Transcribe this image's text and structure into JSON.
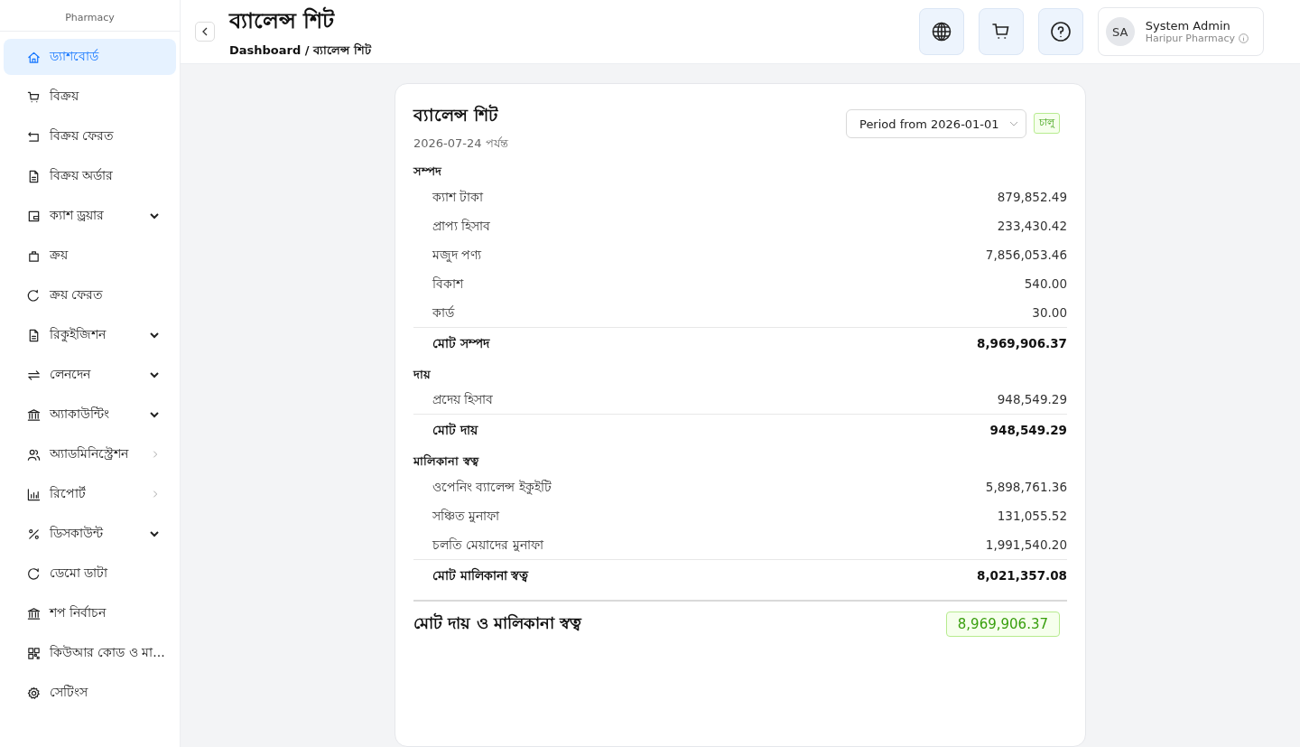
{
  "sidebar": {
    "brand_subtitle": "Pharmacy",
    "items": [
      {
        "label": "ড্যাশবোর্ড",
        "selected": true
      },
      {
        "label": "বিক্রয়",
        "selected": false
      },
      {
        "label": "বিক্রয় ফেরত",
        "selected": false
      },
      {
        "label": "বিক্রয় অর্ডার",
        "selected": false
      },
      {
        "label": "ক্যাশ ড্রয়ার",
        "selected": false,
        "kind": "submenu"
      },
      {
        "label": "ক্রয়",
        "selected": false
      },
      {
        "label": "ক্রয় ফেরত",
        "selected": false
      },
      {
        "label": "রিকুইজিশন",
        "selected": false,
        "kind": "submenu"
      },
      {
        "label": "লেনদেন",
        "selected": false,
        "kind": "submenu"
      },
      {
        "label": "অ্যাকাউন্টিং",
        "selected": false,
        "kind": "submenu"
      },
      {
        "label": "অ্যাডমিনিস্ট্রেশন",
        "selected": false,
        "kind": "flyout"
      },
      {
        "label": "রিপোর্ট",
        "selected": false,
        "kind": "flyout"
      },
      {
        "label": "ডিসকাউন্ট",
        "selected": false,
        "kind": "submenu"
      },
      {
        "label": "ডেমো ডাটা",
        "selected": false
      },
      {
        "label": "শপ নির্বাচন",
        "selected": false
      },
      {
        "label": "কিউআর কোড ও মা...",
        "selected": false
      },
      {
        "label": "সেটিংস",
        "selected": false
      }
    ]
  },
  "header": {
    "title": "ব্যালেন্স শিট",
    "breadcrumb": "Dashboard / ব্যালেন্স শিট",
    "user": {
      "initials": "SA",
      "name": "System Admin",
      "subtitle": "Haripur Pharmacy"
    }
  },
  "report": {
    "title": "ব্যালেন্স শিট",
    "subtitle": "2026-07-24 পর্যন্ত",
    "period": "Period from 2026-01-01",
    "status": "চালু",
    "sections": [
      {
        "heading": "সম্পদ",
        "rows": [
          {
            "label": "ক্যাশ টাকা",
            "amount": "879,852.49"
          },
          {
            "label": "প্রাপ্য হিসাব",
            "amount": "233,430.42"
          },
          {
            "label": "মজুদ পণ্য",
            "amount": "7,856,053.46"
          },
          {
            "label": "বিকাশ",
            "amount": "540.00"
          },
          {
            "label": "কার্ড",
            "amount": "30.00"
          }
        ],
        "total": {
          "label": "মোট সম্পদ",
          "amount": "8,969,906.37"
        }
      },
      {
        "heading": "দায়",
        "rows": [
          {
            "label": "প্রদেয় হিসাব",
            "amount": "948,549.29"
          }
        ],
        "total": {
          "label": "মোট দায়",
          "amount": "948,549.29"
        }
      },
      {
        "heading": "মালিকানা স্বত্ব",
        "rows": [
          {
            "label": "ওপেনিং ব্যালেন্স ইকুইটি",
            "amount": "5,898,761.36"
          },
          {
            "label": "সঞ্চিত মুনাফা",
            "amount": "131,055.52"
          },
          {
            "label": "চলতি মেয়াদের মুনাফা",
            "amount": "1,991,540.20"
          }
        ],
        "total": {
          "label": "মোট মালিকানা স্বত্ব",
          "amount": "8,021,357.08"
        }
      }
    ],
    "grand_total": {
      "label": "মোট দায় ও মালিকানা স্বত্ব",
      "amount": "8,969,906.37"
    }
  }
}
